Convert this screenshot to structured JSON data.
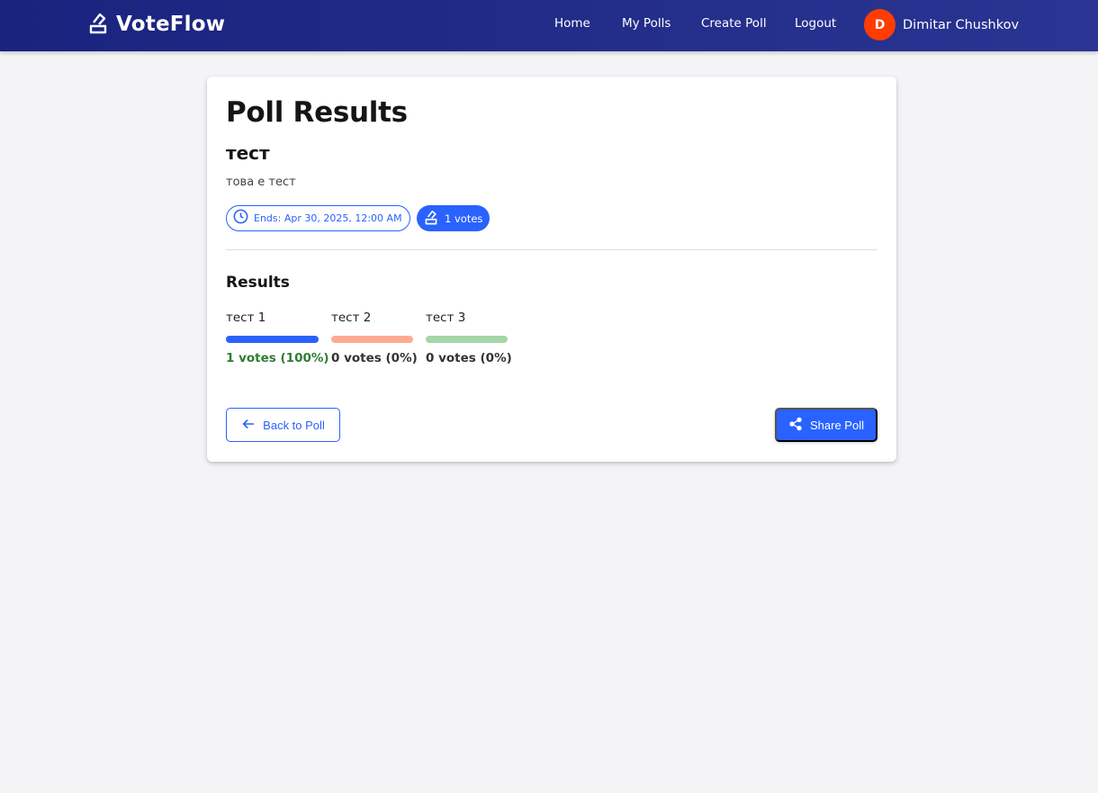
{
  "app": {
    "name": "VoteFlow",
    "logo_icon": "ballot-box-icon"
  },
  "nav": {
    "links": [
      "Home",
      "My Polls",
      "Create Poll",
      "Logout"
    ],
    "user": {
      "initial": "D",
      "name": "Dimitar Chushkov",
      "avatar_color": "#ff3d00"
    }
  },
  "page": {
    "title": "Poll Results"
  },
  "poll": {
    "name": "тест",
    "description": "това е тест",
    "ends_label": "Ends: Apr 30, 2025, 12:00 AM",
    "votes_label": "1 votes"
  },
  "results": {
    "heading": "Results",
    "options": [
      {
        "label": "тест 1",
        "count_text": "1 votes (100%)",
        "percent": 100,
        "color": "#2962ff",
        "count_color": "#2e7d32"
      },
      {
        "label": "тест 2",
        "count_text": "0 votes (0%)",
        "percent": 0,
        "color": "#ffab91",
        "count_color": "#333333"
      },
      {
        "label": "тест 3",
        "count_text": "0 votes (0%)",
        "percent": 0,
        "color": "#a5d6a7",
        "count_color": "#333333"
      }
    ]
  },
  "actions": {
    "back_label": "Back to Poll",
    "share_label": "Share Poll"
  },
  "colors": {
    "primary": "#2962ff",
    "nav_bg": "#1a237e",
    "page_bg": "#f4f4f6"
  }
}
